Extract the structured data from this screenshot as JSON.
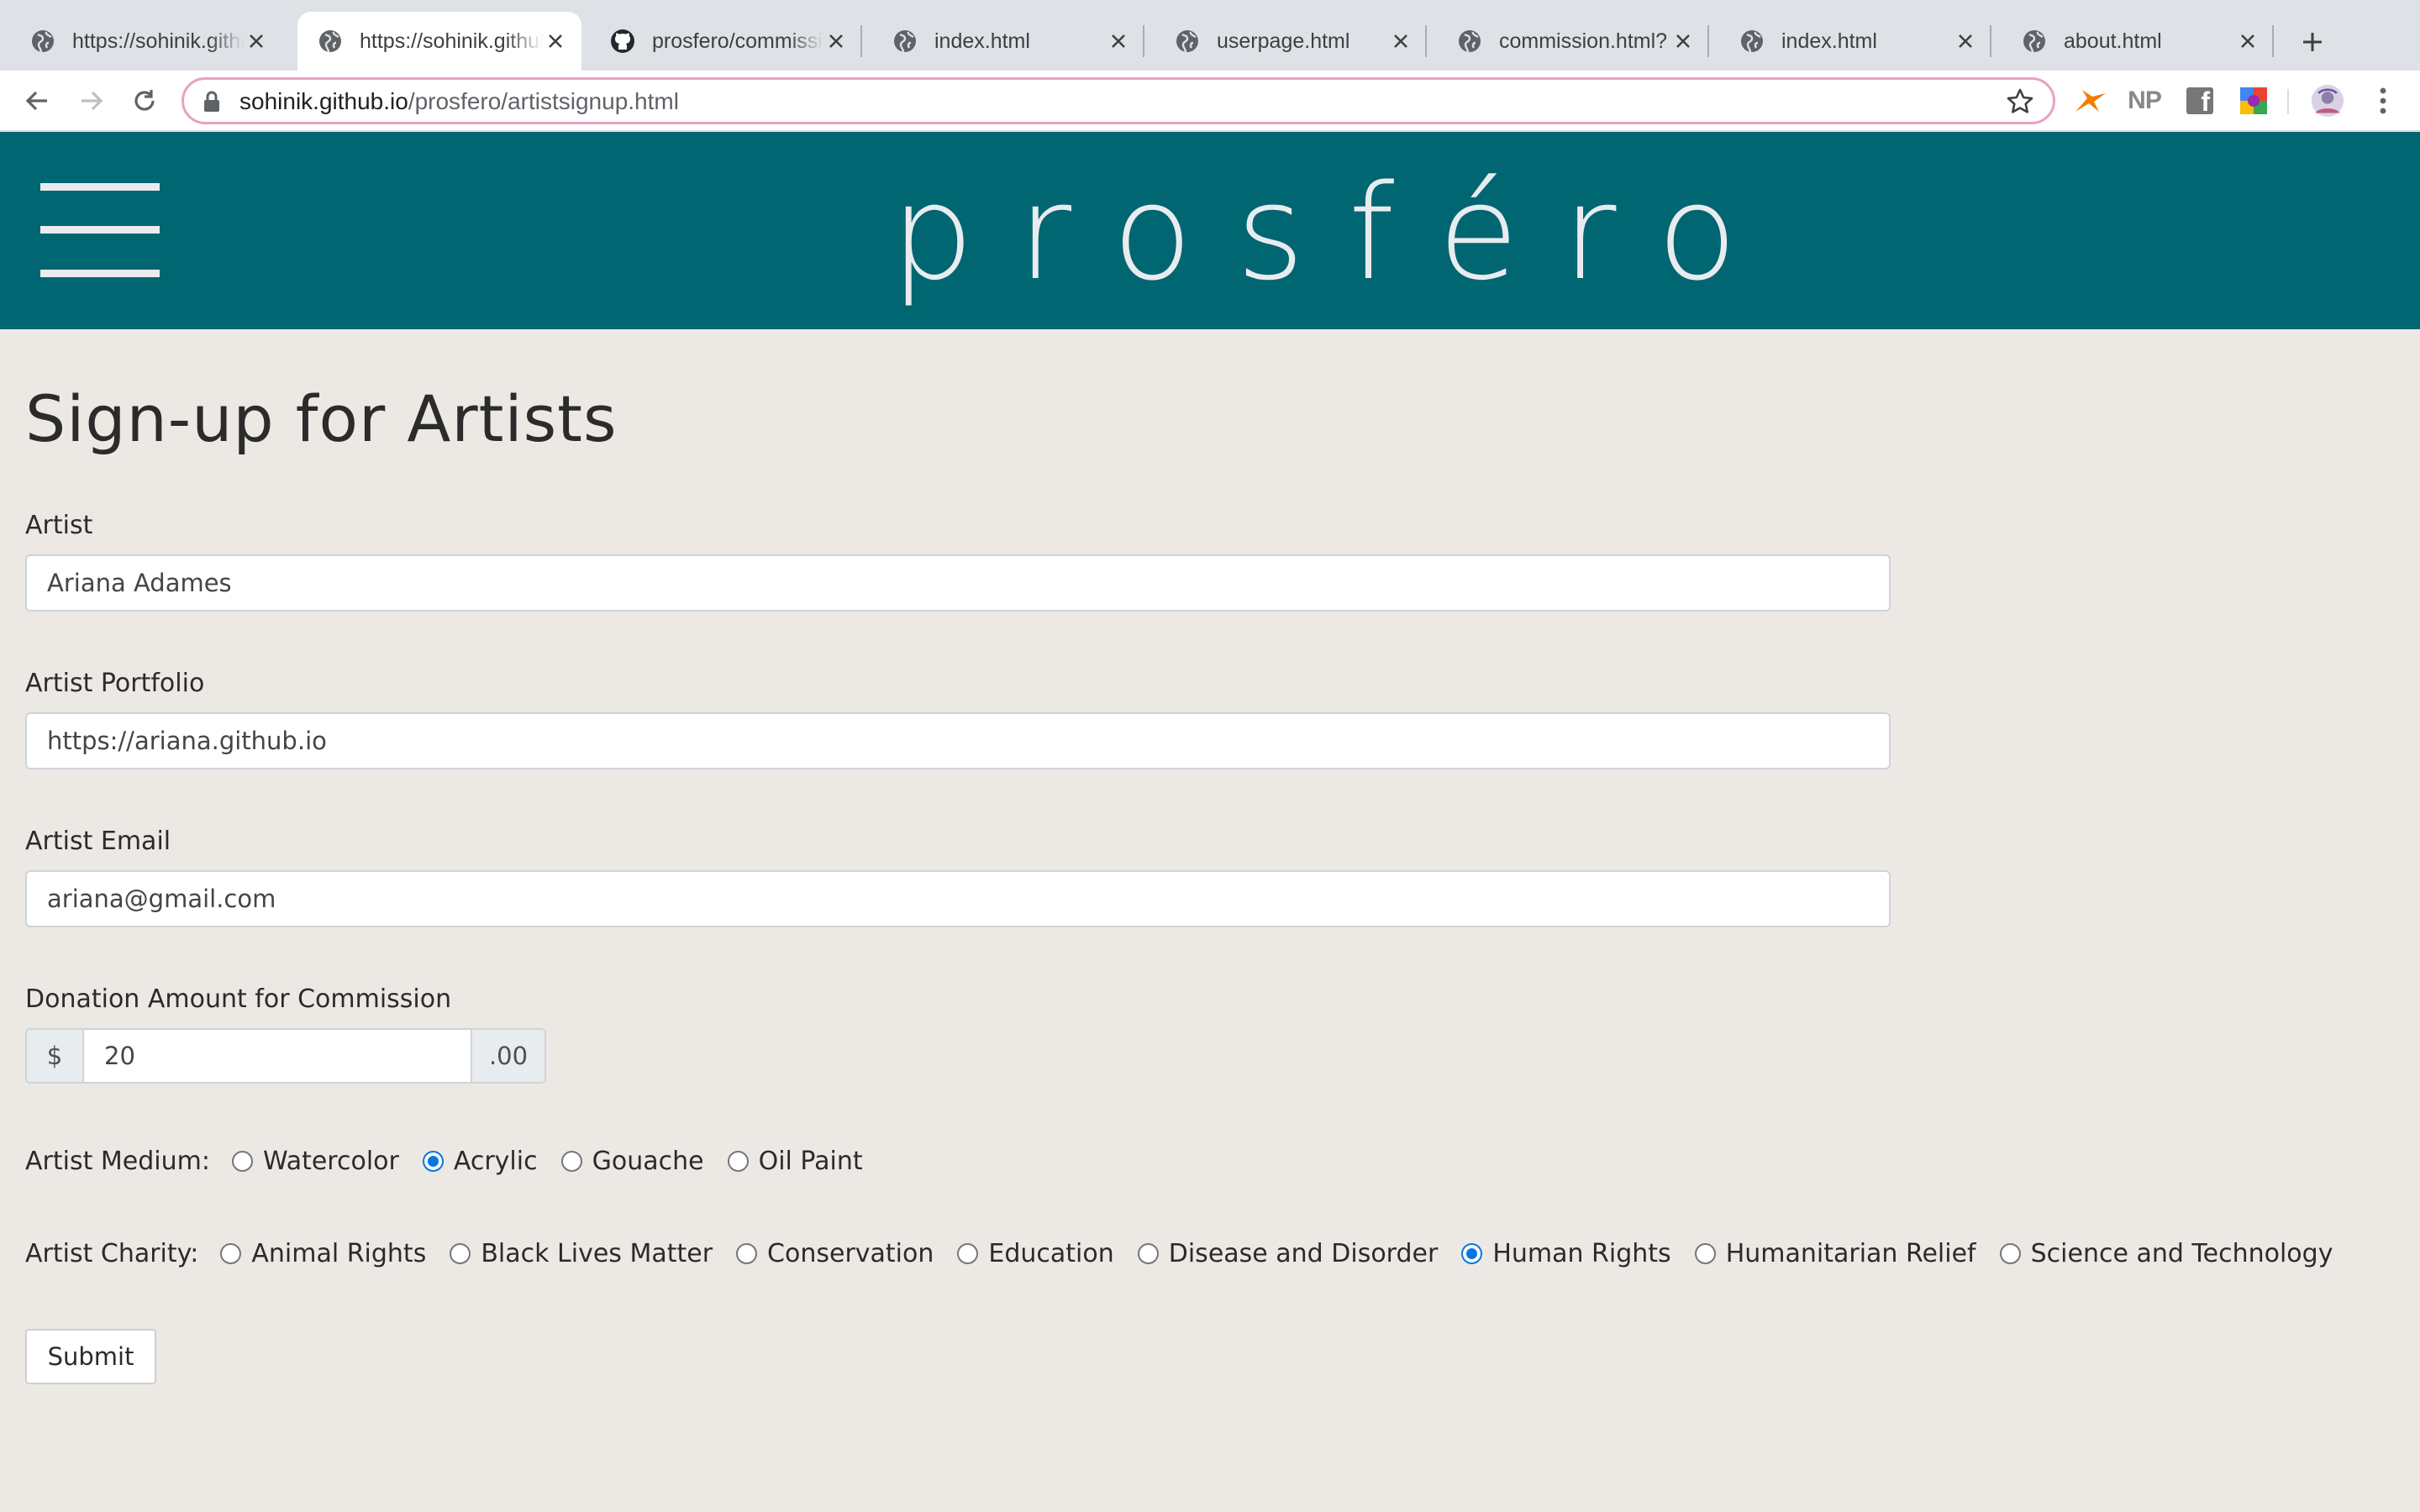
{
  "browser": {
    "tabs": [
      {
        "title": "https://sohinik.github.io/prosfero/",
        "active": false
      },
      {
        "title": "https://sohinik.github.io/prosfero/artistsignup.html",
        "active": true
      },
      {
        "title": "prosfero/commission.html",
        "active": false
      },
      {
        "title": "index.html",
        "active": false
      },
      {
        "title": "userpage.html",
        "active": false
      },
      {
        "title": "commission.html?",
        "active": false
      },
      {
        "title": "index.html",
        "active": false
      },
      {
        "title": "about.html",
        "active": false
      }
    ],
    "url_host": "sohinik.github.io",
    "url_path": "/prosfero/artistsignup.html",
    "extensions": [
      {
        "name": "orange-bird-extension-icon",
        "color": "#f57c00"
      },
      {
        "name": "np-extension-icon",
        "label": "NP"
      },
      {
        "name": "facebook-extension-icon",
        "label": "f"
      },
      {
        "name": "colorful-extension-icon"
      },
      {
        "name": "profile-avatar"
      }
    ]
  },
  "header": {
    "brand": "prosféro",
    "background": "#006672"
  },
  "form": {
    "title": "Sign-up for Artists",
    "artist_label": "Artist",
    "artist_value": "Ariana Adames",
    "portfolio_label": "Artist Portfolio",
    "portfolio_value": "https://ariana.github.io",
    "email_label": "Artist Email",
    "email_value": "ariana@gmail.com",
    "donation_label": "Donation Amount for Commission",
    "donation_prefix": "$",
    "donation_value": "20",
    "donation_suffix": ".00",
    "medium_label": "Artist Medium:",
    "medium_options": [
      {
        "label": "Watercolor",
        "checked": false
      },
      {
        "label": "Acrylic",
        "checked": true
      },
      {
        "label": "Gouache",
        "checked": false
      },
      {
        "label": "Oil Paint",
        "checked": false
      }
    ],
    "charity_label": "Artist Charity:",
    "charity_options": [
      {
        "label": "Animal Rights",
        "checked": false
      },
      {
        "label": "Black Lives Matter",
        "checked": false
      },
      {
        "label": "Conservation",
        "checked": false
      },
      {
        "label": "Education",
        "checked": false
      },
      {
        "label": "Disease and Disorder",
        "checked": false
      },
      {
        "label": "Human Rights",
        "checked": true
      },
      {
        "label": "Humanitarian Relief",
        "checked": false
      },
      {
        "label": "Science and Technology",
        "checked": false
      }
    ],
    "submit_label": "Submit",
    "accent": "#0a75e0"
  }
}
